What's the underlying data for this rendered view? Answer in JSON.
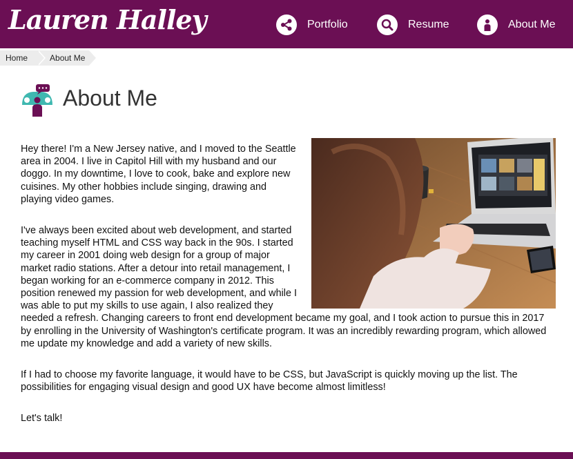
{
  "site": {
    "logo_text": "Lauren Halley"
  },
  "nav": [
    {
      "label": "Portfolio",
      "icon": "share-icon"
    },
    {
      "label": "Resume",
      "icon": "search-icon"
    },
    {
      "label": "About Me",
      "icon": "person-icon"
    }
  ],
  "breadcrumb": [
    "Home",
    "About Me"
  ],
  "page": {
    "title": "About Me",
    "title_icon": "chat-people-icon"
  },
  "content": {
    "paragraphs": [
      "Hey there! I'm a New Jersey native, and I moved to the Seattle area in 2004. I live in Capitol Hill with my husband and our doggo. In my downtime, I love to cook, bake and explore new cuisines. My other hobbies include singing, drawing and playing video games.",
      "I've always been excited about web development, and started teaching myself HTML and CSS way back in the 90s. I started my career in 2001 doing web design for a group of major market radio stations. After a detour into retail management, I began working for an e-commerce company in 2012. This position renewed my passion for web development, and while I was able to put my skills to use again, I also realized they needed a refresh. Changing careers to front end development became my goal, and I took action to pursue this in 2017 by enrolling in the University of Washington's certificate program. It was an incredibly rewarding program, which allowed me update my knowledge and add a variety of new skills.",
      "If I had to choose my favorite language, it would have to be CSS, but JavaScript is quickly moving up the list. The possibilities for engaging visual design and good UX have become almost limitless!",
      "Let's talk!"
    ]
  },
  "colors": {
    "brand": "#6b0f54",
    "accent_teal": "#3fb8b0",
    "breadcrumb_bg": "#ececec"
  }
}
